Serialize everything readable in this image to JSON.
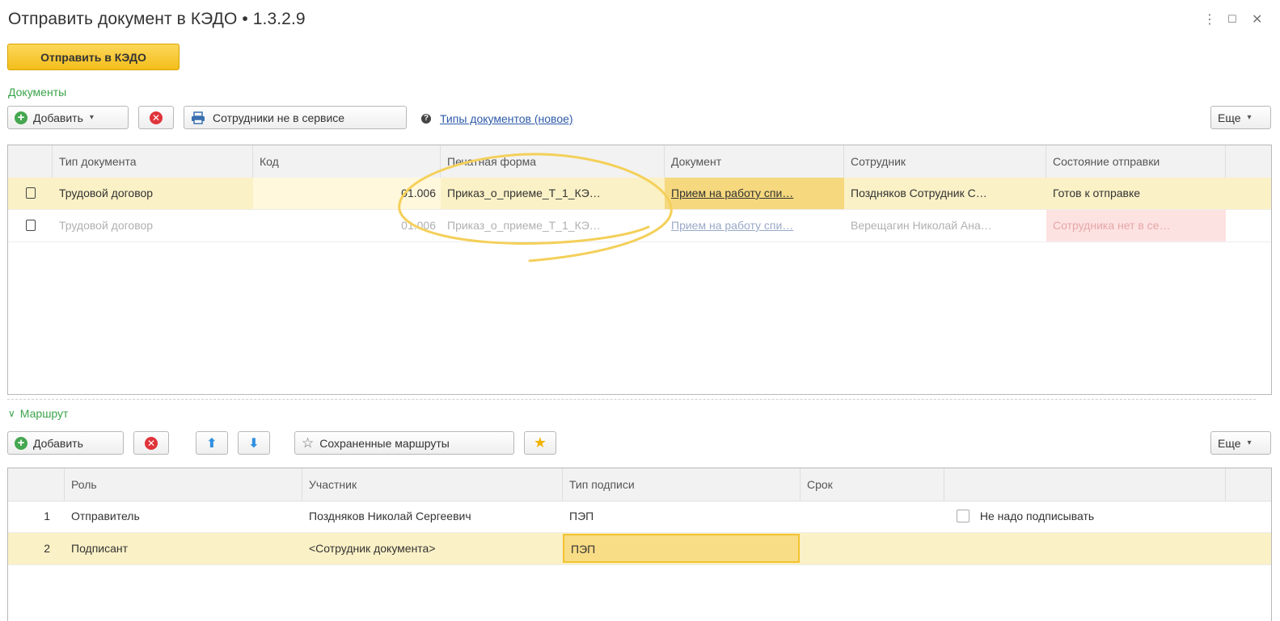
{
  "window": {
    "title": "Отправить документ в КЭДО • 1.3.2.9",
    "more_glyph": "⋮",
    "maximize_glyph": "☐",
    "close_glyph": "✕"
  },
  "toolbar": {
    "send_label": "Отправить в КЭДО"
  },
  "documents": {
    "section_label": "Документы",
    "add_label": "Добавить",
    "employees_label": "Сотрудники не в сервисе",
    "doc_types_link": "Типы документов (новое)",
    "more_label": "Еще",
    "columns": [
      "Тип документа",
      "Код",
      "Печатная форма",
      "Документ",
      "Сотрудник",
      "Состояние отправки"
    ],
    "rows": [
      {
        "type": "Трудовой договор",
        "code": "01.006",
        "print_form": "Приказ_о_приеме_Т_1_КЭ…",
        "document": "Прием на работу спи…",
        "employee": "Поздняков Сотрудник С…",
        "status": "Готов к отправке"
      },
      {
        "type": "Трудовой договор",
        "code": "01.006",
        "print_form": "Приказ_о_приеме_Т_1_КЭ…",
        "document": "Прием на работу спи…",
        "employee": "Верещагин Николай Ана…",
        "status": "Сотрудника нет в се…"
      }
    ]
  },
  "route": {
    "section_label": "Маршрут",
    "add_label": "Добавить",
    "saved_routes_label": "Сохраненные маршруты",
    "more_label": "Еще",
    "columns": [
      "Роль",
      "Участник",
      "Тип подписи",
      "Срок",
      ""
    ],
    "rows": [
      {
        "num": "1",
        "role": "Отправитель",
        "participant": "Поздняков Николай Сергеевич",
        "sign_type": "ПЭП",
        "term": "",
        "extra": "Не надо подписывать"
      },
      {
        "num": "2",
        "role": "Подписант",
        "participant": "<Сотрудник документа>",
        "sign_type": "ПЭП",
        "term": "",
        "extra": ""
      }
    ]
  },
  "colors": {
    "accent_yellow": "#f3be1b",
    "section_green": "#3ba34a",
    "selection": "#fbf1c6",
    "annotation": "#f4d05a"
  }
}
